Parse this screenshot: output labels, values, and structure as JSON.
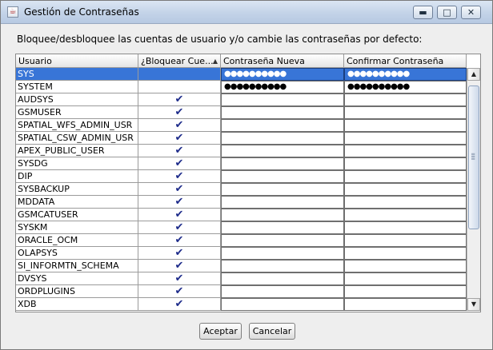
{
  "window": {
    "title": "Gestión de Contraseñas",
    "minimize_glyph": "▬",
    "maximize_glyph": "□",
    "close_glyph": "✕"
  },
  "instruction": "Bloquee/desbloquee las cuentas de usuario y/o cambie las contraseñas por defecto:",
  "table": {
    "columns": [
      "Usuario",
      "¿Bloquear Cue...",
      "Contraseña Nueva",
      "Confirmar Contraseña"
    ],
    "sort_column": "¿Bloquear Cue...",
    "sort_direction": "ascending",
    "check_glyph": "✔",
    "rows": [
      {
        "user": "SYS",
        "locked": false,
        "new_password": "●●●●●●●●●●",
        "confirm_password": "●●●●●●●●●●",
        "selected": true
      },
      {
        "user": "SYSTEM",
        "locked": false,
        "new_password": "●●●●●●●●●●",
        "confirm_password": "●●●●●●●●●●",
        "selected": false
      },
      {
        "user": "AUDSYS",
        "locked": true,
        "new_password": "",
        "confirm_password": "",
        "selected": false
      },
      {
        "user": "GSMUSER",
        "locked": true,
        "new_password": "",
        "confirm_password": "",
        "selected": false
      },
      {
        "user": "SPATIAL_WFS_ADMIN_USR",
        "locked": true,
        "new_password": "",
        "confirm_password": "",
        "selected": false
      },
      {
        "user": "SPATIAL_CSW_ADMIN_USR",
        "locked": true,
        "new_password": "",
        "confirm_password": "",
        "selected": false
      },
      {
        "user": "APEX_PUBLIC_USER",
        "locked": true,
        "new_password": "",
        "confirm_password": "",
        "selected": false
      },
      {
        "user": "SYSDG",
        "locked": true,
        "new_password": "",
        "confirm_password": "",
        "selected": false
      },
      {
        "user": "DIP",
        "locked": true,
        "new_password": "",
        "confirm_password": "",
        "selected": false
      },
      {
        "user": "SYSBACKUP",
        "locked": true,
        "new_password": "",
        "confirm_password": "",
        "selected": false
      },
      {
        "user": "MDDATA",
        "locked": true,
        "new_password": "",
        "confirm_password": "",
        "selected": false
      },
      {
        "user": "GSMCATUSER",
        "locked": true,
        "new_password": "",
        "confirm_password": "",
        "selected": false
      },
      {
        "user": "SYSKM",
        "locked": true,
        "new_password": "",
        "confirm_password": "",
        "selected": false
      },
      {
        "user": "ORACLE_OCM",
        "locked": true,
        "new_password": "",
        "confirm_password": "",
        "selected": false
      },
      {
        "user": "OLAPSYS",
        "locked": true,
        "new_password": "",
        "confirm_password": "",
        "selected": false
      },
      {
        "user": "SI_INFORMTN_SCHEMA",
        "locked": true,
        "new_password": "",
        "confirm_password": "",
        "selected": false
      },
      {
        "user": "DVSYS",
        "locked": true,
        "new_password": "",
        "confirm_password": "",
        "selected": false
      },
      {
        "user": "ORDPLUGINS",
        "locked": true,
        "new_password": "",
        "confirm_password": "",
        "selected": false
      },
      {
        "user": "XDB",
        "locked": true,
        "new_password": "",
        "confirm_password": "",
        "selected": false
      }
    ]
  },
  "buttons": {
    "accept": "Aceptar",
    "cancel": "Cancelar"
  },
  "colors": {
    "selection": "#3875d7",
    "check": "#1d2b8a",
    "titlebar": "#c3d3e8"
  },
  "icons": {
    "app": "java-cup-icon",
    "sort": "sort-ascending-icon",
    "check": "checkmark-icon"
  }
}
